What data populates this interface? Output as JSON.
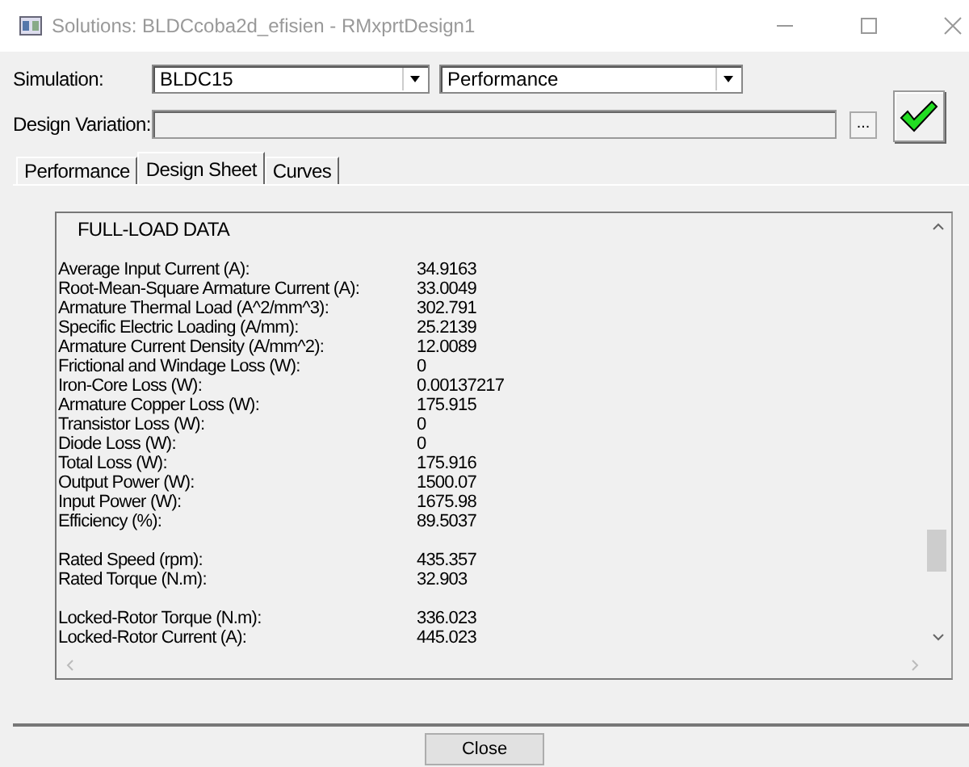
{
  "window": {
    "title": "Solutions: BLDCcoba2d_efisien - RMxprtDesign1"
  },
  "simulation": {
    "label": "Simulation:",
    "setup": "BLDC15",
    "report": "Performance"
  },
  "design_variation": {
    "label": "Design Variation:",
    "browse": "...",
    "valid": true
  },
  "tabs": [
    {
      "label": "Performance",
      "selected": false
    },
    {
      "label": "Design Sheet",
      "selected": true
    },
    {
      "label": "Curves",
      "selected": false
    }
  ],
  "sheet": {
    "heading": "FULL-LOAD DATA",
    "groups": [
      {
        "rows": [
          {
            "label": "Average Input Current (A):",
            "value": "34.9163"
          },
          {
            "label": "Root-Mean-Square Armature Current (A):",
            "value": "33.0049"
          },
          {
            "label": "Armature Thermal Load (A^2/mm^3):",
            "value": "302.791"
          },
          {
            "label": "Specific Electric Loading (A/mm):",
            "value": "25.2139"
          },
          {
            "label": "Armature Current Density (A/mm^2):",
            "value": "12.0089"
          },
          {
            "label": "Frictional and Windage Loss (W):",
            "value": "0"
          },
          {
            "label": "Iron-Core Loss (W):",
            "value": "0.00137217"
          },
          {
            "label": "Armature Copper Loss (W):",
            "value": "175.915"
          },
          {
            "label": "Transistor Loss (W):",
            "value": "0"
          },
          {
            "label": "Diode Loss (W):",
            "value": "0"
          },
          {
            "label": "Total Loss (W):",
            "value": "175.916"
          },
          {
            "label": "Output Power (W):",
            "value": "1500.07"
          },
          {
            "label": "Input Power (W):",
            "value": "1675.98"
          },
          {
            "label": "Efficiency (%):",
            "value": "89.5037"
          }
        ]
      },
      {
        "rows": [
          {
            "label": "Rated Speed (rpm):",
            "value": "435.357"
          },
          {
            "label": "Rated Torque (N.m):",
            "value": "32.903"
          }
        ]
      },
      {
        "rows": [
          {
            "label": "Locked-Rotor Torque (N.m):",
            "value": "336.023"
          },
          {
            "label": "Locked-Rotor Current (A):",
            "value": "445.023"
          }
        ]
      }
    ]
  },
  "buttons": [
    "Close"
  ]
}
